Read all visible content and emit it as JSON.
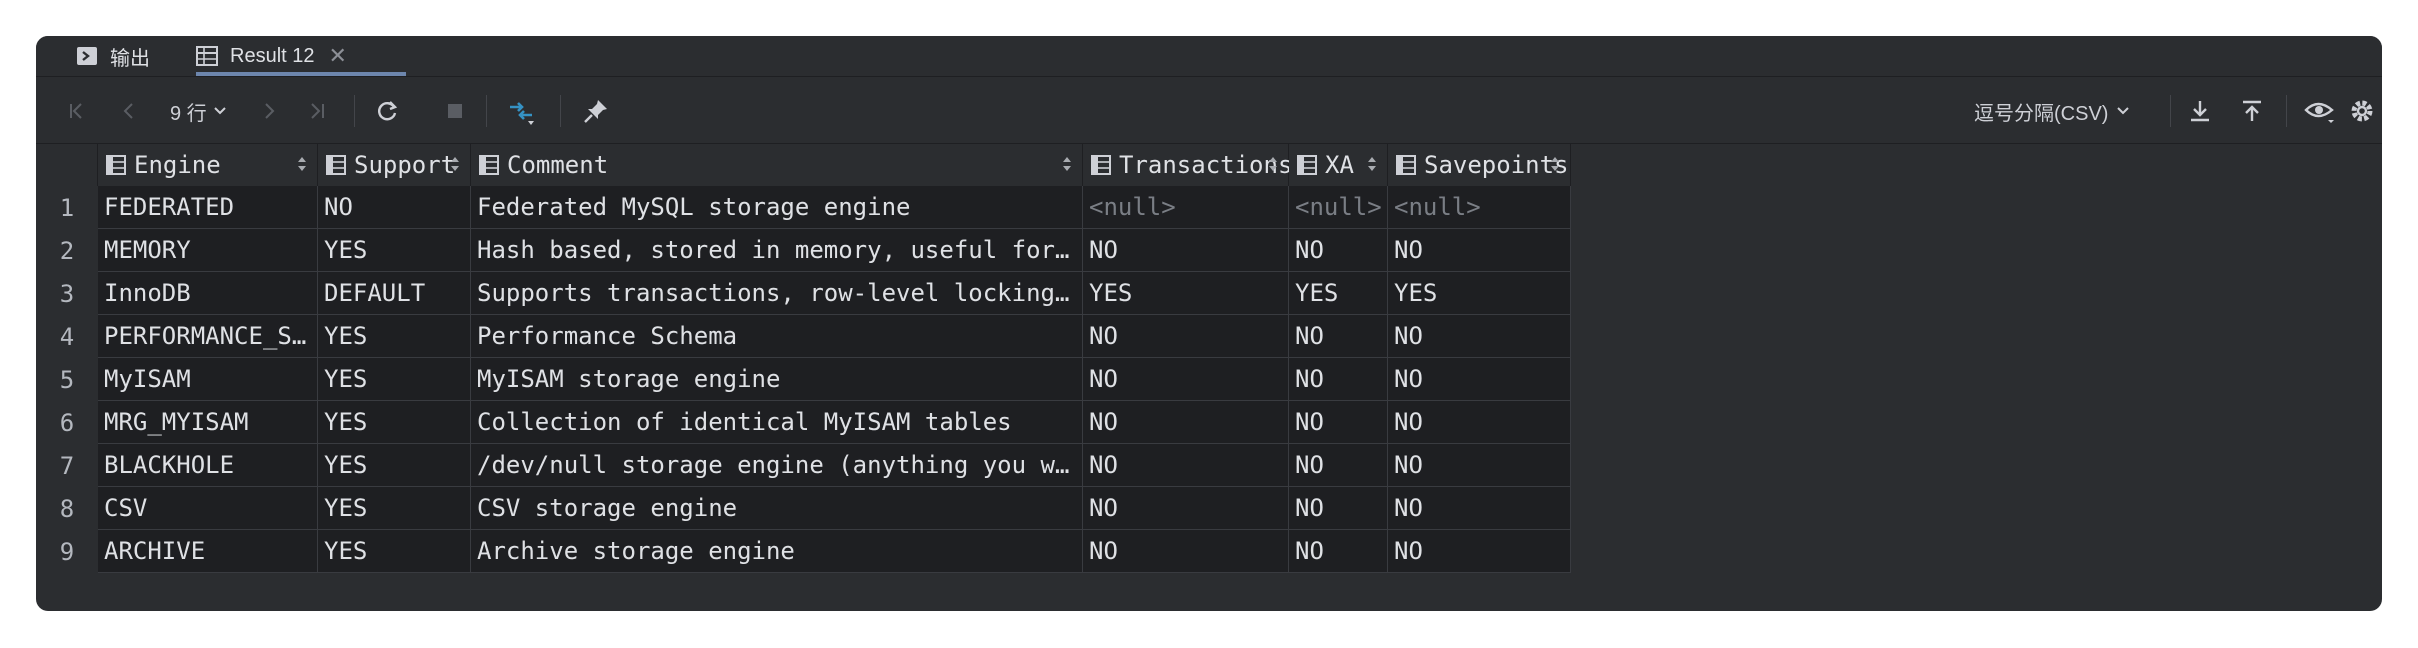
{
  "tabs": [
    {
      "label": "输出",
      "icon": "console-icon"
    },
    {
      "label": "Result 12",
      "icon": "table-icon",
      "close": "✕"
    }
  ],
  "toolbar": {
    "rows_label": "9 行",
    "export_format": "逗号分隔(CSV)"
  },
  "columns": [
    {
      "label": "Engine"
    },
    {
      "label": "Support"
    },
    {
      "label": "Comment"
    },
    {
      "label": "Transactions"
    },
    {
      "label": "XA"
    },
    {
      "label": "Savepoints"
    }
  ],
  "rows": [
    {
      "num": "1",
      "cells": [
        "FEDERATED",
        "NO",
        "Federated MySQL storage engine",
        "<null>",
        "<null>",
        "<null>"
      ]
    },
    {
      "num": "2",
      "cells": [
        "MEMORY",
        "YES",
        "Hash based, stored in memory, useful for temporary tables",
        "NO",
        "NO",
        "NO"
      ]
    },
    {
      "num": "3",
      "cells": [
        "InnoDB",
        "DEFAULT",
        "Supports transactions, row-level locking, and foreign keys",
        "YES",
        "YES",
        "YES"
      ]
    },
    {
      "num": "4",
      "cells": [
        "PERFORMANCE_SCHEMA",
        "YES",
        "Performance Schema",
        "NO",
        "NO",
        "NO"
      ]
    },
    {
      "num": "5",
      "cells": [
        "MyISAM",
        "YES",
        "MyISAM storage engine",
        "NO",
        "NO",
        "NO"
      ]
    },
    {
      "num": "6",
      "cells": [
        "MRG_MYISAM",
        "YES",
        "Collection of identical MyISAM tables",
        "NO",
        "NO",
        "NO"
      ]
    },
    {
      "num": "7",
      "cells": [
        "BLACKHOLE",
        "YES",
        "/dev/null storage engine (anything you write to it disapp…",
        "NO",
        "NO",
        "NO"
      ]
    },
    {
      "num": "8",
      "cells": [
        "CSV",
        "YES",
        "CSV storage engine",
        "NO",
        "NO",
        "NO"
      ]
    },
    {
      "num": "9",
      "cells": [
        "ARCHIVE",
        "YES",
        "Archive storage engine",
        "NO",
        "NO",
        "NO"
      ]
    }
  ],
  "colors": {
    "background": "#1e1f22",
    "panel": "#2b2d30",
    "text": "#dfe1e5",
    "null_text": "#7a7e85",
    "accent": "#3592c4"
  }
}
